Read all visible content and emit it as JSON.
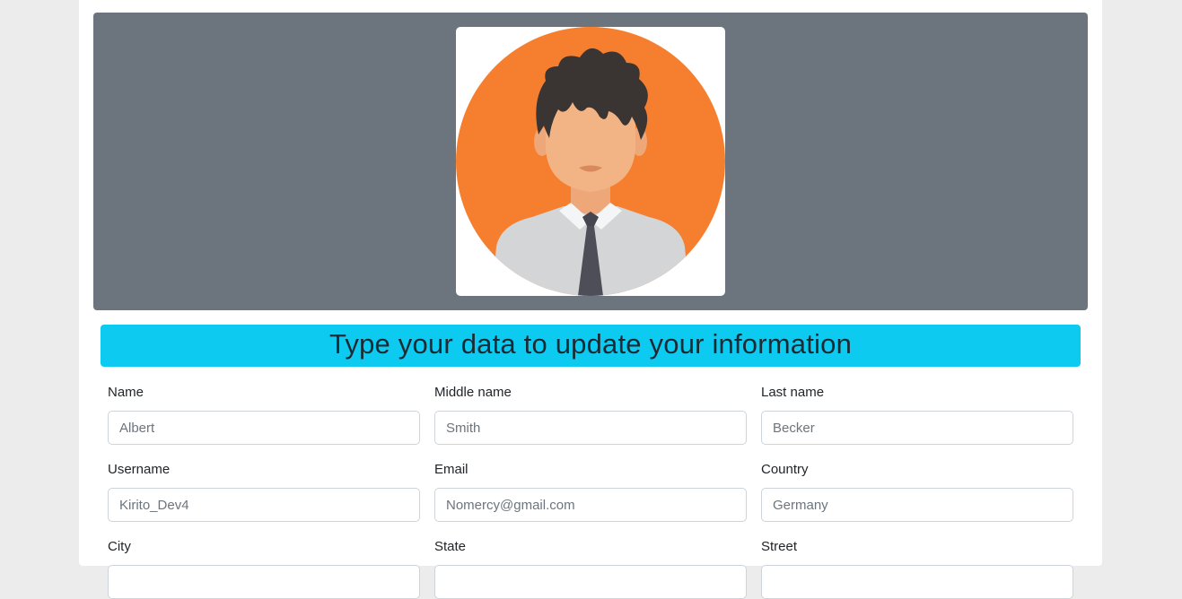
{
  "profile": {
    "avatar_icon": "user-avatar-icon",
    "banner_color": "#6c757d"
  },
  "heading": {
    "title": "Type your data to update your information",
    "bar_color": "#0dcaf0"
  },
  "form": {
    "fields": [
      {
        "label": "Name",
        "placeholder": "Albert"
      },
      {
        "label": "Middle name",
        "placeholder": "Smith"
      },
      {
        "label": "Last name",
        "placeholder": "Becker"
      },
      {
        "label": "Username",
        "placeholder": "Kirito_Dev4"
      },
      {
        "label": "Email",
        "placeholder": "Nomercy@gmail.com"
      },
      {
        "label": "Country",
        "placeholder": "Germany"
      },
      {
        "label": "City",
        "placeholder": ""
      },
      {
        "label": "State",
        "placeholder": ""
      },
      {
        "label": "Street",
        "placeholder": ""
      }
    ]
  }
}
